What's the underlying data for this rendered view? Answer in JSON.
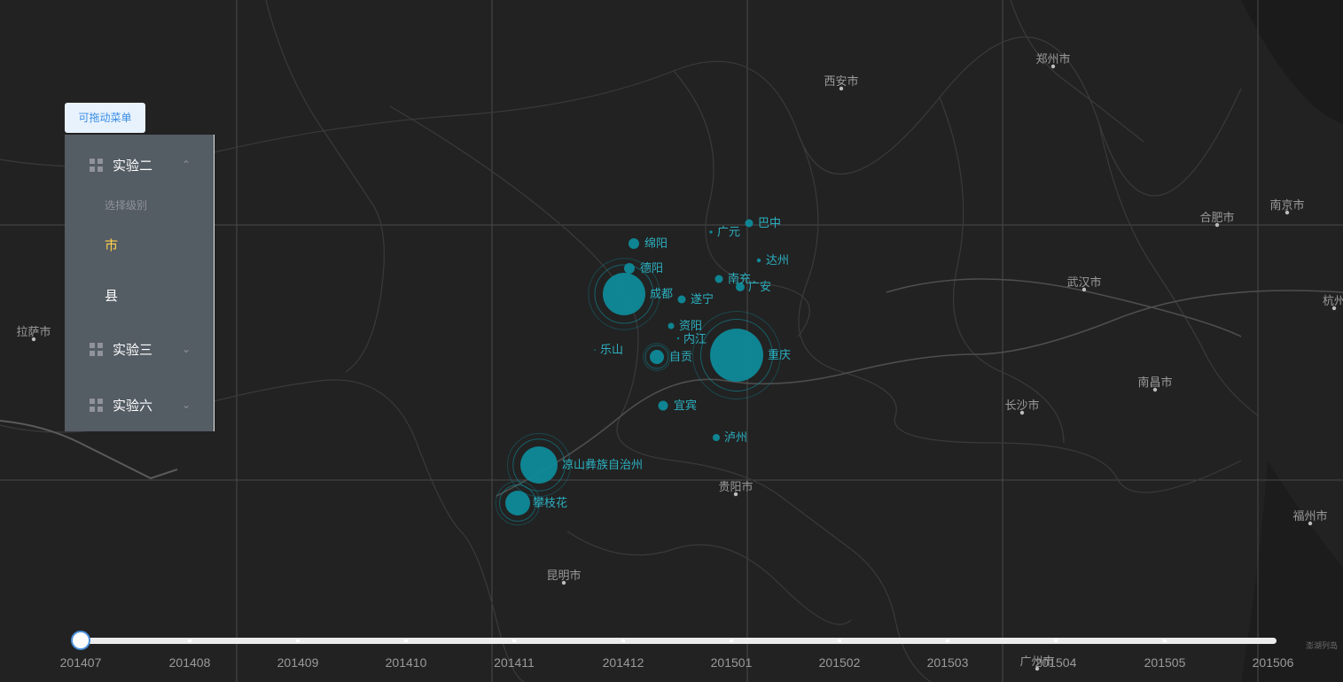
{
  "map": {
    "background_color": "#222222",
    "bubble_color": "#0f8a99",
    "label_color": "#2bb0c0",
    "reference_cities": [
      {
        "name": "西安市"
      },
      {
        "name": "郑州市"
      },
      {
        "name": "南京市"
      },
      {
        "name": "合肥市"
      },
      {
        "name": "武汉市"
      },
      {
        "name": "杭州"
      },
      {
        "name": "拉萨市"
      },
      {
        "name": "南昌市"
      },
      {
        "name": "长沙市"
      },
      {
        "name": "贵阳市"
      },
      {
        "name": "昆明市"
      },
      {
        "name": "福州市"
      },
      {
        "name": "广州市"
      }
    ],
    "points": [
      {
        "name": "巴中"
      },
      {
        "name": "广元"
      },
      {
        "name": "绵阳"
      },
      {
        "name": "达州"
      },
      {
        "name": "德阳"
      },
      {
        "name": "南充"
      },
      {
        "name": "广安"
      },
      {
        "name": "成都"
      },
      {
        "name": "遂宁"
      },
      {
        "name": "资阳"
      },
      {
        "name": "内江"
      },
      {
        "name": "乐山"
      },
      {
        "name": "自贡"
      },
      {
        "name": "重庆"
      },
      {
        "name": "宜宾"
      },
      {
        "name": "泸州"
      },
      {
        "name": "凉山彝族自治州"
      },
      {
        "name": "攀枝花"
      }
    ],
    "attribution": "澎湖列岛"
  },
  "menu": {
    "drag_label": "可拖动菜单",
    "sections": [
      {
        "title": "实验二",
        "expanded": true,
        "icon": "grid-icon"
      },
      {
        "title": "实验三",
        "expanded": false,
        "icon": "grid-icon"
      },
      {
        "title": "实验六",
        "expanded": false,
        "icon": "grid-icon"
      }
    ],
    "group_title": "选择级别",
    "items": [
      {
        "label": "市",
        "active": true,
        "color": "#ffd04b"
      },
      {
        "label": "县",
        "active": false,
        "color": "#ffffff"
      }
    ]
  },
  "timeline": {
    "labels": [
      "201407",
      "201408",
      "201409",
      "201410",
      "201411",
      "201412",
      "201501",
      "201502",
      "201503",
      "201504",
      "201505",
      "201506"
    ],
    "current": "201407",
    "knob_color": "#4a90d9"
  }
}
